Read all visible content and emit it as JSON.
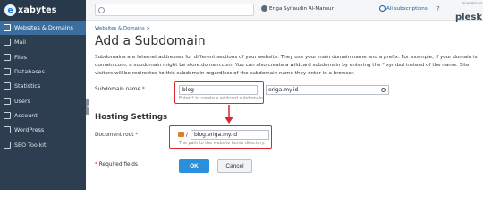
{
  "brand": {
    "logo_mark": "e",
    "logo_text": "xabytes"
  },
  "sidebar": {
    "items": [
      {
        "label": "Websites & Domains",
        "icon": "globe-icon",
        "active": true
      },
      {
        "label": "Mail",
        "icon": "mail-icon"
      },
      {
        "label": "Files",
        "icon": "folder-icon"
      },
      {
        "label": "Databases",
        "icon": "database-icon"
      },
      {
        "label": "Statistics",
        "icon": "chart-icon"
      },
      {
        "label": "Users",
        "icon": "user-icon"
      },
      {
        "label": "Account",
        "icon": "account-icon"
      },
      {
        "label": "WordPress",
        "icon": "wordpress-icon"
      },
      {
        "label": "SEO Toolkit",
        "icon": "seo-icon"
      }
    ]
  },
  "topbar": {
    "user_name": "Eriga Syifaudin Al-Mansur",
    "subscriptions": "All subscriptions",
    "powered_by": "POWERED BY",
    "plesk": "plesk"
  },
  "breadcrumb": "Websites & Domains >",
  "title": "Add a Subdomain",
  "description": "Subdomains are Internet addresses for different sections of your website. They use your main domain name and a prefix. For example, if your domain is domain.com, a subdomain might be store.domain.com. You can also create a wildcard subdomain by entering the * symbol instead of the name. Site visitors will be redirected to this subdomain regardless of the subdomain name they enter in a browser.",
  "form": {
    "subdomain_label": "Subdomain name",
    "subdomain_value": "blog",
    "subdomain_hint": "Enter * to create a wildcard subdomain",
    "domain_value": "eriga.my.id",
    "hosting_title": "Hosting Settings",
    "docroot_label": "Document root",
    "docroot_prefix": "/",
    "docroot_value": "blog.eriga.my.id",
    "docroot_hint": "The path to the website home directory.",
    "required_note": "Required fields",
    "required_mark": "*",
    "ok": "OK",
    "cancel": "Cancel"
  },
  "colors": {
    "accent": "#2b8fd9",
    "annotation": "#d9282f",
    "sidebar": "#2c3e50"
  }
}
